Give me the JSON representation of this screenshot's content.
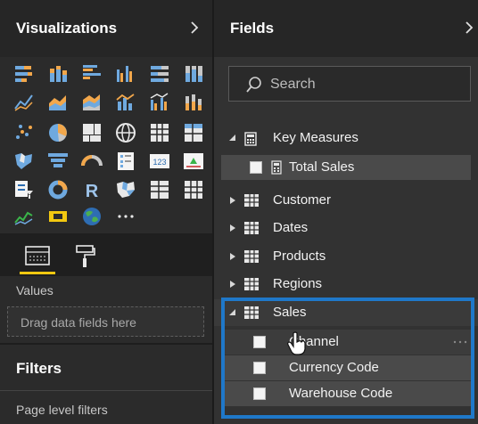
{
  "visualizations": {
    "title": "Visualizations",
    "header_icon": "chevron-right-icon",
    "tabs": [
      {
        "name": "fields-tab",
        "icon": "fields-well-icon",
        "active": true
      },
      {
        "name": "format-tab",
        "icon": "paint-roller-icon",
        "active": false
      }
    ],
    "values_label": "Values",
    "drop_placeholder": "Drag data fields here",
    "filters_title": "Filters",
    "page_filters_label": "Page level filters",
    "more_label": "···",
    "visual_icons": [
      "stacked-bar-chart-icon",
      "stacked-column-chart-icon",
      "clustered-bar-chart-icon",
      "clustered-column-chart-icon",
      "100-stacked-bar-chart-icon",
      "100-stacked-column-chart-icon",
      "line-chart-icon",
      "area-chart-icon",
      "stacked-area-chart-icon",
      "line-and-stacked-column-icon",
      "line-and-clustered-column-icon",
      "ribbon-chart-icon",
      "scatter-chart-icon",
      "pie-chart-icon",
      "treemap-icon",
      "map-icon",
      "table-icon",
      "matrix-icon",
      "filled-map-icon",
      "funnel-icon",
      "gauge-icon",
      "multi-row-card-icon",
      "card-icon",
      "kpi-icon",
      "slicer-icon",
      "donut-chart-icon",
      "r-script-visual-icon",
      "shape-map-icon",
      "table-visual-icon",
      "matrix-visual-icon",
      "waterfall-chart-icon",
      "custom-visual-icon",
      "globe-map-icon",
      "more-visuals-icon"
    ]
  },
  "fields": {
    "title": "Fields",
    "header_icon": "chevron-right-icon",
    "search_placeholder": "Search",
    "tables": [
      {
        "name": "Key Measures",
        "expanded": true,
        "icon": "calculator-icon",
        "children": [
          {
            "label": "Total Sales",
            "icon": "calculator-icon"
          }
        ]
      },
      {
        "name": "Customer",
        "expanded": false,
        "icon": "table-icon",
        "children": []
      },
      {
        "name": "Dates",
        "expanded": false,
        "icon": "table-icon",
        "children": []
      },
      {
        "name": "Products",
        "expanded": false,
        "icon": "table-icon",
        "children": []
      },
      {
        "name": "Regions",
        "expanded": false,
        "icon": "table-icon",
        "children": []
      },
      {
        "name": "Sales",
        "expanded": true,
        "icon": "table-icon",
        "children": [
          {
            "label": "Channel"
          },
          {
            "label": "Currency Code"
          },
          {
            "label": "Warehouse Code"
          }
        ]
      }
    ],
    "highlight_color": "#1f78c9"
  },
  "colors": {
    "accent_yellow": "#f2c811",
    "chart_orange": "#f2a74b",
    "chart_blue": "#6fa9df"
  }
}
